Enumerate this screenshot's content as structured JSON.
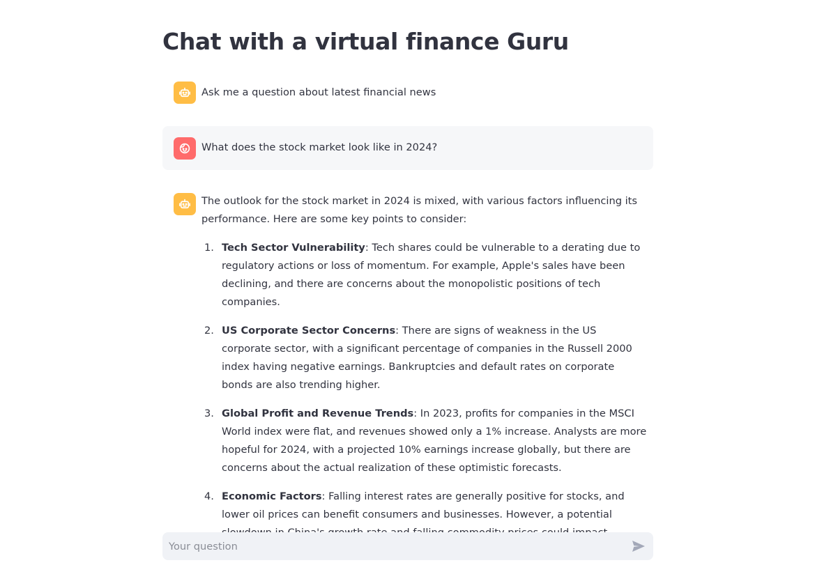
{
  "page": {
    "title": "Chat with a virtual finance Guru"
  },
  "messages": [
    {
      "role": "assistant",
      "avatar_icon": "robot-icon",
      "text": "Ask me a question about latest financial news"
    },
    {
      "role": "user",
      "avatar_icon": "face-icon",
      "text": "What does the stock market look like in 2024?"
    },
    {
      "role": "assistant",
      "avatar_icon": "robot-icon",
      "intro": "The outlook for the stock market in 2024 is mixed, with various factors influencing its performance. Here are some key points to consider:",
      "points": [
        {
          "number": "1.",
          "heading": "Tech Sector Vulnerability",
          "body": ": Tech shares could be vulnerable to a derating due to regulatory actions or loss of momentum. For example, Apple's sales have been declining, and there are concerns about the monopolistic positions of tech companies."
        },
        {
          "number": "2.",
          "heading": "US Corporate Sector Concerns",
          "body": ": There are signs of weakness in the US corporate sector, with a significant percentage of companies in the Russell 2000 index having negative earnings. Bankruptcies and default rates on corporate bonds are also trending higher."
        },
        {
          "number": "3.",
          "heading": "Global Profit and Revenue Trends",
          "body": ": In 2023, profits for companies in the MSCI World index were flat, and revenues showed only a 1% increase. Analysts are more hopeful for 2024, with a projected 10% earnings increase globally, but there are concerns about the actual realization of these optimistic forecasts."
        },
        {
          "number": "4.",
          "heading": "Economic Factors",
          "body": ": Falling interest rates are generally positive for stocks, and lower oil prices can benefit consumers and businesses. However, a potential slowdown in China's growth rate and falling commodity prices could impact emerging markets."
        }
      ]
    }
  ],
  "chat_input": {
    "placeholder": "Your question",
    "value": "",
    "send_icon": "send-icon"
  },
  "colors": {
    "assistant_avatar": "#ffbd45",
    "user_avatar": "#ff6b6b",
    "user_message_bg": "#f6f7f9",
    "input_bg": "#f0f2f6",
    "text": "#31333f"
  }
}
